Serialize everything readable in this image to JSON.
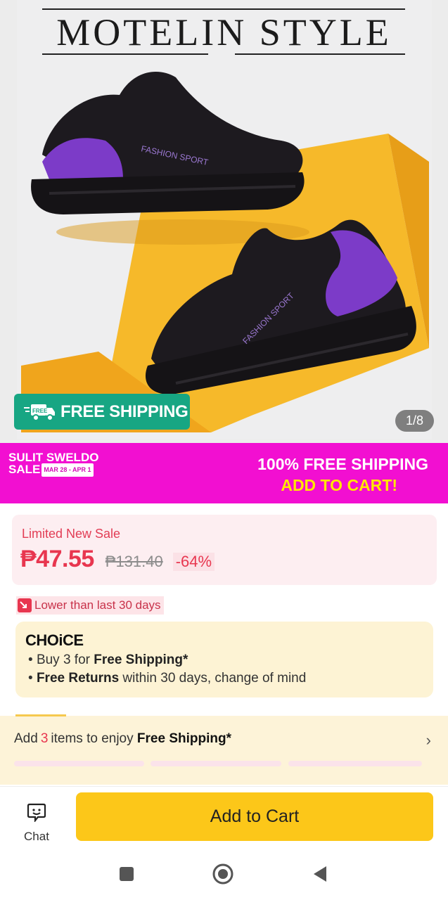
{
  "hero": {
    "brand_title": "MOTELIN STYLE",
    "free_shipping_label": "FREE SHIPPING",
    "free_icon_text": "FREE",
    "pager": "1/8",
    "shoe_text": "FASHION SPORT"
  },
  "promo": {
    "left_line1": "SULIT SWELDO",
    "left_line2": "SALE",
    "date": "MAR 28 - APR 1",
    "right_line1": "100% FREE SHIPPING",
    "right_line2": "ADD TO CART!"
  },
  "price": {
    "sale_label": "Limited New Sale",
    "current": "₱47.55",
    "original": "₱131.40",
    "discount": "-64%",
    "lower_note": "Lower than last 30 days"
  },
  "choice": {
    "logo": "CHOiCE",
    "line1_prefix": "Buy 3 for ",
    "line1_bold": "Free Shipping*",
    "line2_bold": "Free Returns",
    "line2_suffix": " within 30 days, change of mind"
  },
  "free_shipping_strip": {
    "prefix": "Add",
    "count": "3",
    "middle": "items to enjoy",
    "bold": "Free Shipping*",
    "chevron": "›"
  },
  "bottom_bar": {
    "chat_label": "Chat",
    "add_to_cart": "Add to Cart"
  },
  "icons": {
    "free_badge": "truck-icon",
    "chat": "chat-icon",
    "nav_recent": "square-icon",
    "nav_home": "circle-icon",
    "nav_back": "triangle-back-icon"
  },
  "colors": {
    "promo_bg": "#f20fd1",
    "free_badge_bg": "#17a683",
    "price_red": "#e8364f",
    "cart_button": "#fcc719",
    "choice_bg": "#fdf3d4"
  }
}
